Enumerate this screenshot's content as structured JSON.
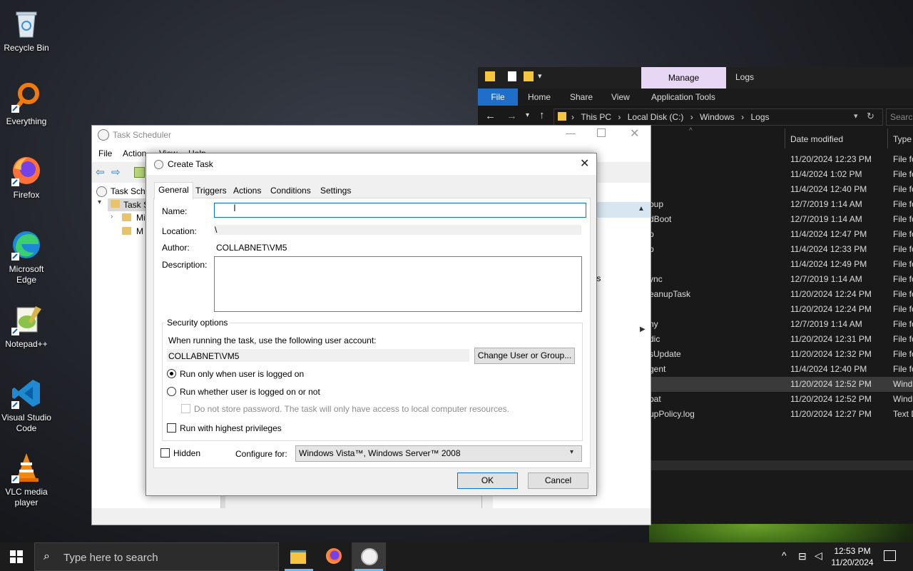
{
  "desktop": {
    "icons": [
      {
        "label": "Recycle Bin"
      },
      {
        "label": "Everything"
      },
      {
        "label": "Firefox"
      },
      {
        "label": "Microsoft Edge"
      },
      {
        "label": "Notepad++"
      },
      {
        "label": "Visual Studio Code"
      },
      {
        "label": "VLC media player"
      }
    ]
  },
  "explorer": {
    "ribbon_tabs": {
      "manage": "Manage",
      "logs": "Logs"
    },
    "menu": {
      "file": "File",
      "home": "Home",
      "share": "Share",
      "view": "View",
      "app_tools": "Application Tools"
    },
    "breadcrumb": [
      "This PC",
      "Local Disk (C:)",
      "Windows",
      "Logs"
    ],
    "search_placeholder": "Search",
    "columns": {
      "date_modified": "Date modified",
      "type": "Type"
    },
    "rows": [
      {
        "name": "",
        "date": "11/20/2024 12:23 PM",
        "type": "File fo"
      },
      {
        "name": "",
        "date": "11/4/2024 1:02 PM",
        "type": "File fo"
      },
      {
        "name": "",
        "date": "11/4/2024 12:40 PM",
        "type": "File fo"
      },
      {
        "name": "oup",
        "date": "12/7/2019 1:14 AM",
        "type": "File fo"
      },
      {
        "name": "dBoot",
        "date": "12/7/2019 1:14 AM",
        "type": "File fo"
      },
      {
        "name": "p",
        "date": "11/4/2024 12:47 PM",
        "type": "File fo"
      },
      {
        "name": "p",
        "date": "11/4/2024 12:33 PM",
        "type": "File fo"
      },
      {
        "name": "",
        "date": "11/4/2024 12:49 PM",
        "type": "File fo"
      },
      {
        "name": "ync",
        "date": "12/7/2019 1:14 AM",
        "type": "File fo"
      },
      {
        "name": "eanupTask",
        "date": "11/20/2024 12:24 PM",
        "type": "File fo"
      },
      {
        "name": "",
        "date": "11/20/2024 12:24 PM",
        "type": "File fo"
      },
      {
        "name": "ny",
        "date": "12/7/2019 1:14 AM",
        "type": "File fo"
      },
      {
        "name": "dic",
        "date": "11/20/2024 12:31 PM",
        "type": "File fo"
      },
      {
        "name": "sUpdate",
        "date": "11/20/2024 12:32 PM",
        "type": "File fo"
      },
      {
        "name": "gent",
        "date": "11/4/2024 12:40 PM",
        "type": "File fo"
      },
      {
        "name": "",
        "date": "11/20/2024 12:52 PM",
        "type": "Wind"
      },
      {
        "name": "bat",
        "date": "11/20/2024 12:52 PM",
        "type": "Wind"
      },
      {
        "name": "upPolicy.log",
        "date": "11/20/2024 12:27 PM",
        "type": "Text D"
      }
    ]
  },
  "task_scheduler": {
    "title": "Task Scheduler",
    "menu": {
      "file": "File",
      "action": "Action",
      "view": "View",
      "help": "Help"
    },
    "tree": {
      "root": "Task Sche",
      "child": "Task S",
      "sub1": "Mi",
      "sub2": "M"
    },
    "side_text": "ts"
  },
  "dialog": {
    "title": "Create Task",
    "tabs": [
      "General",
      "Triggers",
      "Actions",
      "Conditions",
      "Settings"
    ],
    "name_label": "Name:",
    "name_value": "",
    "location_label": "Location:",
    "location_value": "\\",
    "author_label": "Author:",
    "author_value": "COLLABNET\\VM5",
    "description_label": "Description:",
    "description_value": "",
    "security": {
      "legend": "Security options",
      "account_prompt": "When running the task, use the following user account:",
      "account_value": "COLLABNET\\VM5",
      "change_button": "Change User or Group...",
      "radio_logged_on": "Run only when user is logged on",
      "radio_whether": "Run whether user is logged on or not",
      "no_store_password": "Do not store password.  The task will only have access to local computer resources.",
      "highest_privileges": "Run with highest privileges"
    },
    "hidden_label": "Hidden",
    "configure_label": "Configure for:",
    "configure_value": "Windows Vista™, Windows Server™ 2008",
    "ok": "OK",
    "cancel": "Cancel"
  },
  "taskbar": {
    "search_placeholder": "Type here to search",
    "time": "12:53 PM",
    "date": "11/20/2024"
  }
}
